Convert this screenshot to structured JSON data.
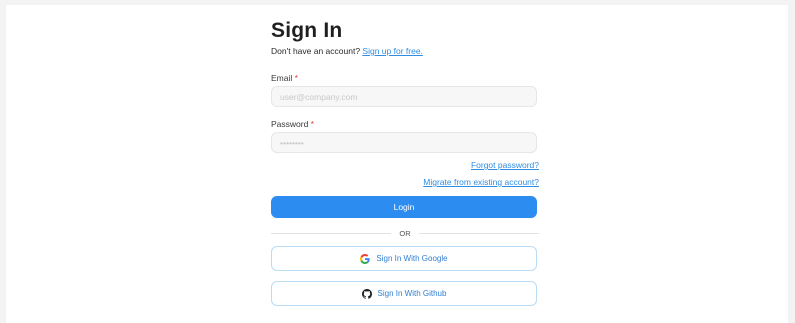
{
  "heading": "Sign In",
  "signup": {
    "prompt": "Don't have an account?",
    "link": "Sign up for free."
  },
  "email": {
    "label": "Email",
    "required_mark": "*",
    "placeholder": "user@company.com",
    "value": ""
  },
  "password": {
    "label": "Password",
    "required_mark": "*",
    "placeholder": "••••••••",
    "value": ""
  },
  "links": {
    "forgot": "Forgot password?",
    "migrate": "Migrate from existing account?"
  },
  "login_button": "Login",
  "divider_text": "OR",
  "social": {
    "google": {
      "label": "Sign In With Google",
      "icon": "google-icon"
    },
    "github": {
      "label": "Sign In With Github",
      "icon": "github-icon"
    }
  },
  "colors": {
    "accent": "#2d8cf0",
    "link": "#2f8de4",
    "required": "#e0403a",
    "social_border": "#b9dcf7"
  }
}
